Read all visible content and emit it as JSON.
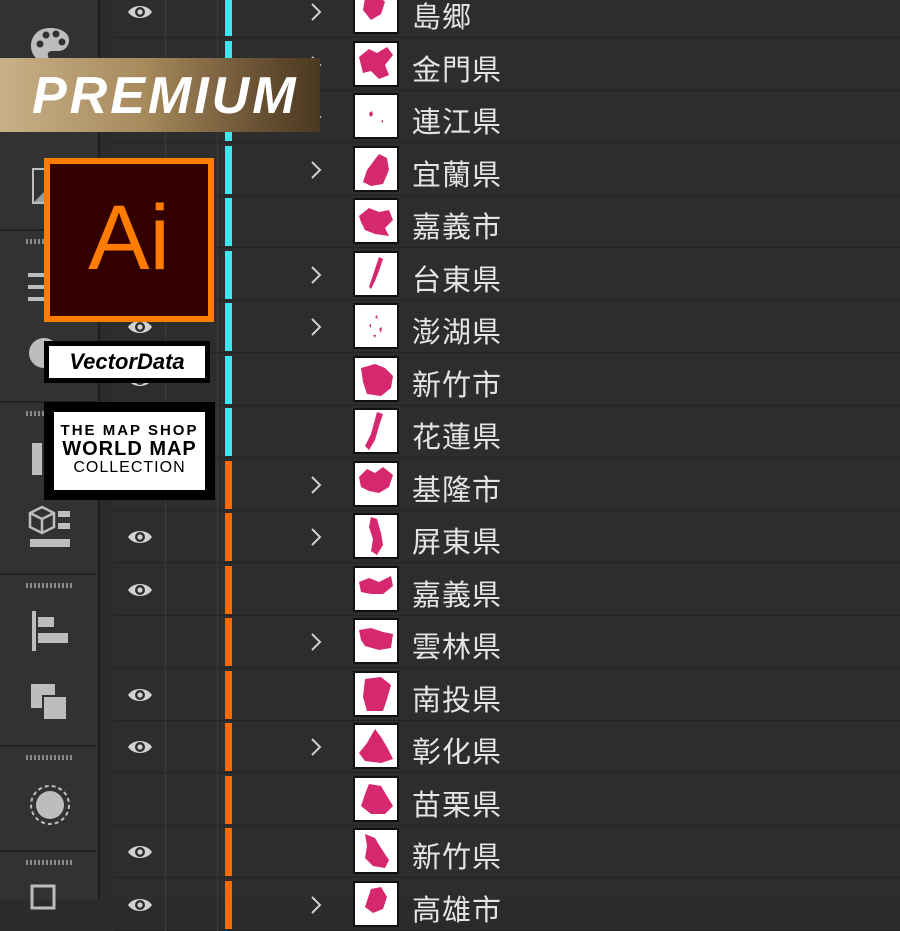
{
  "badges": {
    "premium": "PREMIUM",
    "app_logo": "Ai",
    "vector_data": "VectorData",
    "map_shop": [
      "THE MAP SHOP",
      "WORLD MAP",
      "COLLECTION"
    ]
  },
  "colors": {
    "layer_color_cyan": "#3fe6f0",
    "layer_color_orange": "#ff6a00",
    "shape_fill": "#d6286e",
    "panel_bg": "#2d2d2d",
    "text": "#e4e4e4"
  },
  "layers": [
    {
      "name": "島郷",
      "eye": true,
      "chevron": true,
      "color": "cyan"
    },
    {
      "name": "金門県",
      "eye": true,
      "chevron": true,
      "color": "cyan"
    },
    {
      "name": "連江県",
      "eye": true,
      "chevron": true,
      "color": "cyan"
    },
    {
      "name": "宜蘭県",
      "eye": true,
      "chevron": true,
      "color": "cyan"
    },
    {
      "name": "嘉義市",
      "eye": true,
      "chevron": false,
      "color": "cyan"
    },
    {
      "name": "台東県",
      "eye": true,
      "chevron": true,
      "color": "cyan"
    },
    {
      "name": "澎湖県",
      "eye": true,
      "chevron": true,
      "color": "cyan"
    },
    {
      "name": "新竹市",
      "eye": true,
      "chevron": false,
      "color": "cyan"
    },
    {
      "name": "花蓮県",
      "eye": true,
      "chevron": false,
      "color": "cyan"
    },
    {
      "name": "基隆市",
      "eye": true,
      "chevron": true,
      "color": "orange"
    },
    {
      "name": "屏東県",
      "eye": true,
      "chevron": true,
      "color": "orange"
    },
    {
      "name": "嘉義県",
      "eye": true,
      "chevron": false,
      "color": "orange"
    },
    {
      "name": "雲林県",
      "eye": false,
      "chevron": true,
      "color": "orange"
    },
    {
      "name": "南投県",
      "eye": true,
      "chevron": false,
      "color": "orange"
    },
    {
      "name": "彰化県",
      "eye": true,
      "chevron": true,
      "color": "orange"
    },
    {
      "name": "苗栗県",
      "eye": false,
      "chevron": false,
      "color": "orange"
    },
    {
      "name": "新竹県",
      "eye": true,
      "chevron": false,
      "color": "orange"
    },
    {
      "name": "高雄市",
      "eye": true,
      "chevron": true,
      "color": "orange"
    }
  ],
  "toolbar_icons": [
    "palette-icon",
    "gradient-icon",
    "align-lines-icon",
    "color-guide-icon",
    "artboard-icon",
    "3d-materials-icon",
    "align-icon",
    "pathfinder-icon",
    "appearance-icon",
    "artboards-panel-icon"
  ]
}
